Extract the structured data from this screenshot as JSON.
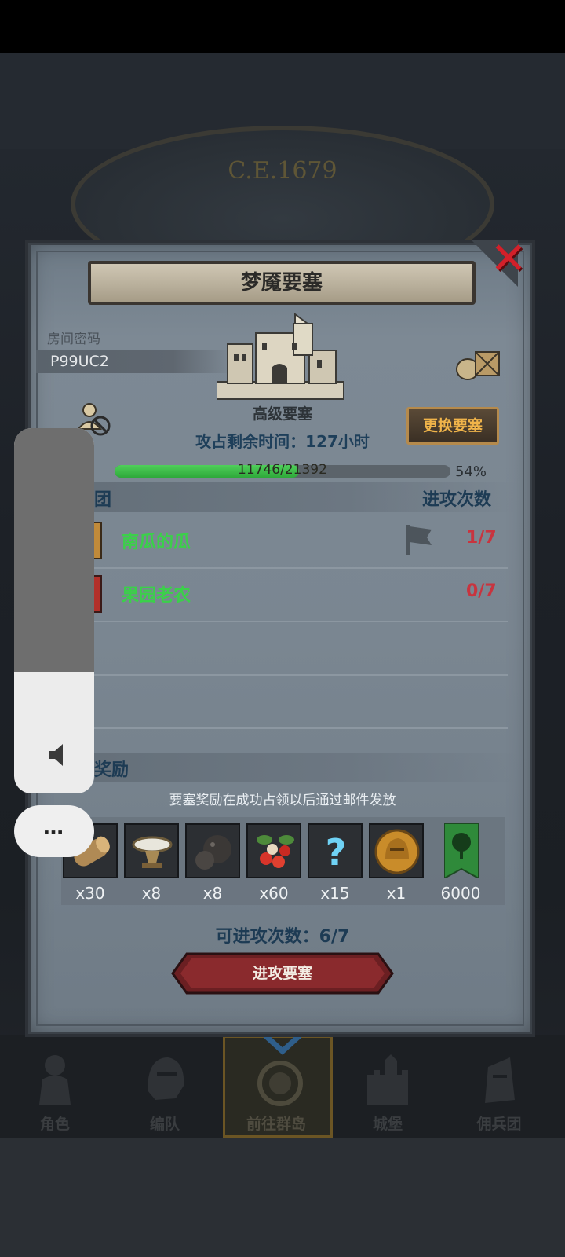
{
  "background": {
    "year": "C.E.1679"
  },
  "dialog": {
    "title": "梦魇要塞",
    "room": {
      "label": "房间密码",
      "code": "P99UC2"
    },
    "fortress_level": "高级要塞",
    "change_button": "更换要塞",
    "remaining_time": "攻占剩余时间：127小时",
    "progress": {
      "text": "11746/21392",
      "percent_label": "54%",
      "fraction": 0.549
    },
    "teams_section": {
      "title": "团",
      "attack_col": "进攻次数"
    },
    "teams": [
      {
        "name": "南瓜的瓜",
        "count": "1/7"
      },
      {
        "name": "果园老农",
        "count": "0/7"
      }
    ],
    "reward_section": {
      "title": "奖励",
      "note": "要塞奖励在成功占领以后通过邮件发放"
    },
    "rewards": [
      {
        "icon": "wood-log-icon",
        "qty": "x30"
      },
      {
        "icon": "bowl-icon",
        "qty": "x8"
      },
      {
        "icon": "truffle-icon",
        "qty": "x8"
      },
      {
        "icon": "berries-icon",
        "qty": "x60"
      },
      {
        "icon": "mystery-icon",
        "qty": "x15"
      },
      {
        "icon": "helmet-coin-icon",
        "qty": "x1"
      },
      {
        "icon": "tree-banner-icon",
        "qty": "6000"
      }
    ],
    "attack_count": "可进攻次数：6/7",
    "attack_button": "进攻要塞"
  },
  "nav": [
    {
      "label": "角色",
      "icon": "knight-icon"
    },
    {
      "label": "编队",
      "icon": "helmet-icon"
    },
    {
      "label": "前往群岛",
      "icon": "compass-icon",
      "active": true
    },
    {
      "label": "城堡",
      "icon": "castle-icon"
    },
    {
      "label": "佣兵团",
      "icon": "mercenary-icon"
    }
  ],
  "overlay": {
    "more": "…"
  },
  "colors": {
    "accent": "#f0b44a",
    "green": "#3bd04a",
    "red": "#c8343f",
    "close": "#d3202a"
  }
}
